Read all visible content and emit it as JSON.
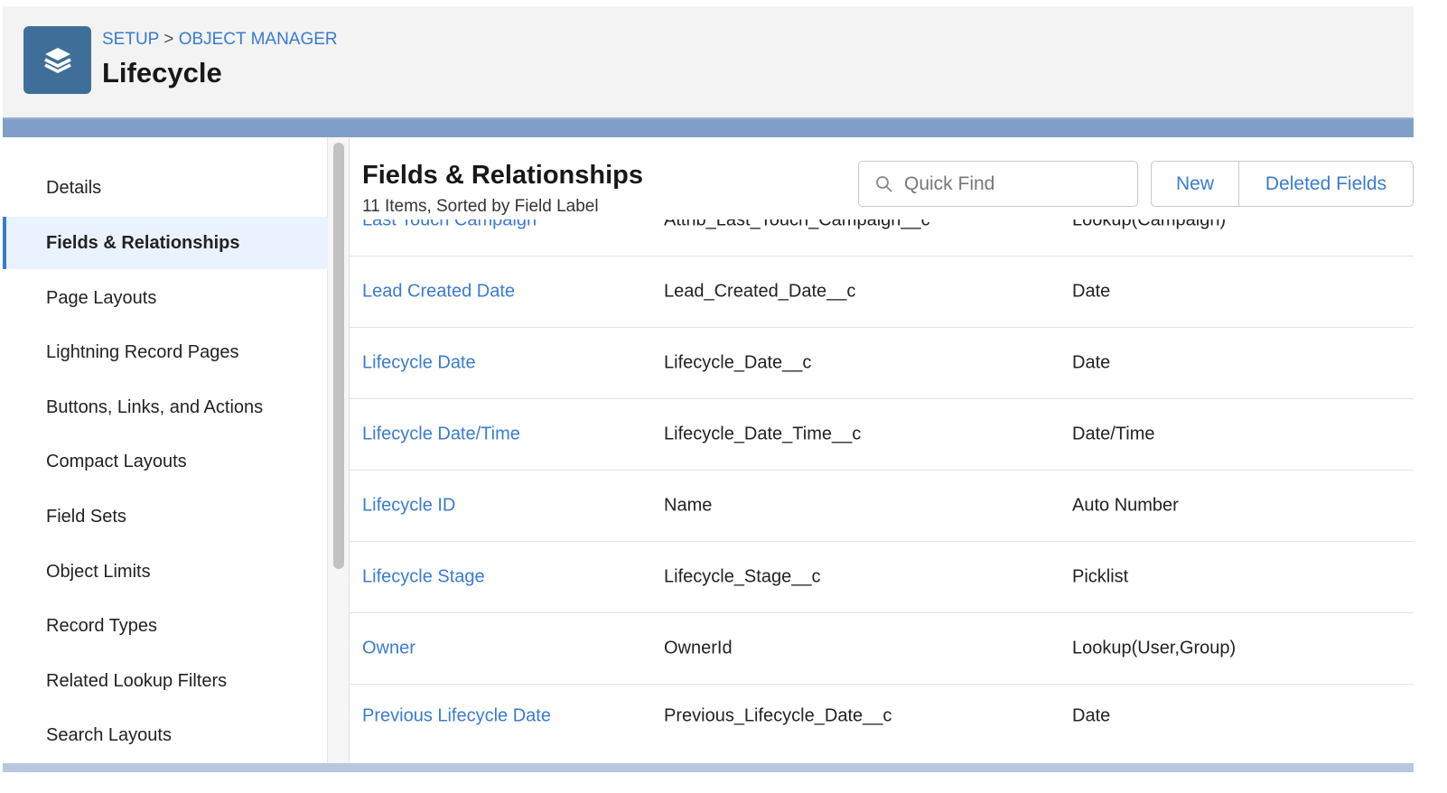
{
  "header": {
    "breadcrumb": [
      "SETUP",
      "OBJECT MANAGER"
    ],
    "separator": ">",
    "title": "Lifecycle",
    "icon": "layers-icon"
  },
  "sidebar": {
    "active": "Fields & Relationships",
    "items": [
      "Details",
      "Fields & Relationships",
      "Page Layouts",
      "Lightning Record Pages",
      "Buttons, Links, and Actions",
      "Compact Layouts",
      "Field Sets",
      "Object Limits",
      "Record Types",
      "Related Lookup Filters",
      "Search Layouts"
    ]
  },
  "main": {
    "title": "Fields & Relationships",
    "subtitle": "11 Items, Sorted by Field Label",
    "search_placeholder": "Quick Find",
    "new_label": "New",
    "deleted_label": "Deleted Fields",
    "rows": [
      {
        "label": "Last Touch Campaign",
        "api": "Attrib_Last_Touch_Campaign__c",
        "type": "Lookup(Campaign)"
      },
      {
        "label": "Lead Created Date",
        "api": "Lead_Created_Date__c",
        "type": "Date"
      },
      {
        "label": "Lifecycle Date",
        "api": "Lifecycle_Date__c",
        "type": "Date"
      },
      {
        "label": "Lifecycle Date/Time",
        "api": "Lifecycle_Date_Time__c",
        "type": "Date/Time"
      },
      {
        "label": "Lifecycle ID",
        "api": "Name",
        "type": "Auto Number"
      },
      {
        "label": "Lifecycle Stage",
        "api": "Lifecycle_Stage__c",
        "type": "Picklist"
      },
      {
        "label": "Owner",
        "api": "OwnerId",
        "type": "Lookup(User,Group)"
      },
      {
        "label": "Previous Lifecycle Date",
        "api": "Previous_Lifecycle_Date__c",
        "type": "Date"
      }
    ]
  }
}
